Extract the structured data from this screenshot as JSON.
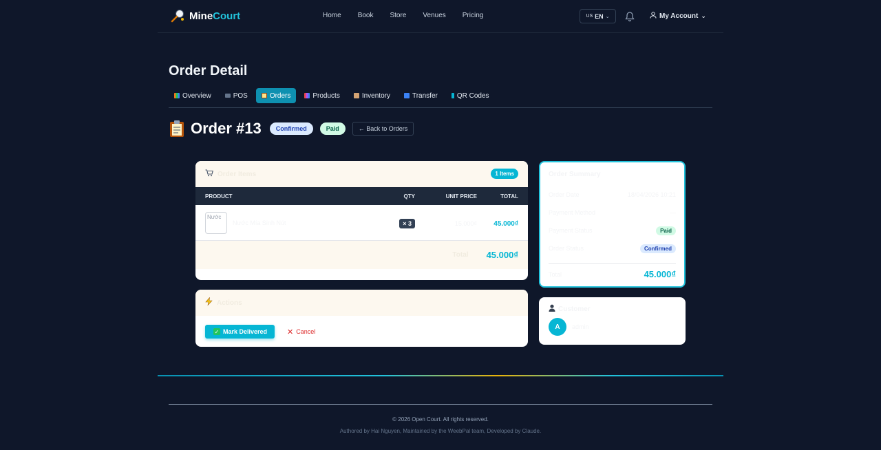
{
  "header": {
    "brand_a": "Mine",
    "brand_b": "Court",
    "nav": [
      "Home",
      "Book",
      "Store",
      "Venues",
      "Pricing"
    ],
    "lang_flag": "US",
    "lang": "EN",
    "account": "My Account"
  },
  "page": {
    "title": "Order Detail",
    "tabs": [
      {
        "label": "Overview",
        "icon": "chart-icon"
      },
      {
        "label": "POS",
        "icon": "laptop-icon"
      },
      {
        "label": "Orders",
        "icon": "clipboard-icon",
        "active": true
      },
      {
        "label": "Products",
        "icon": "bar-chart-icon"
      },
      {
        "label": "Inventory",
        "icon": "box-icon"
      },
      {
        "label": "Transfer",
        "icon": "refresh-icon"
      },
      {
        "label": "QR Codes",
        "icon": "qr-icon"
      }
    ]
  },
  "order": {
    "title": "Order #13",
    "status_badge": "Confirmed",
    "payment_badge": "Paid",
    "back_label": "← Back to Orders"
  },
  "items": {
    "title": "Order Items",
    "count": "1 Items",
    "headers": {
      "product": "PRODUCT",
      "qty": "QTY",
      "unit": "UNIT PRICE",
      "total": "TOTAL"
    },
    "rows": [
      {
        "img_alt": "Nước",
        "name": "Nước Mía Sinh Nút",
        "qty": "× 3",
        "unit": "15.000₫",
        "total": "45.000₫"
      }
    ],
    "total_label": "Total",
    "total_value": "45.000₫"
  },
  "actions": {
    "title": "Actions",
    "deliver_label": "Mark Delivered",
    "cancel_label": "Cancel"
  },
  "summary": {
    "title": "Order Summary",
    "rows": {
      "date_label": "Order Date",
      "date_value": "18/04/2026 10:21",
      "method_label": "Payment Method",
      "method_value": "—",
      "pay_status_label": "Payment Status",
      "pay_status_value": "Paid",
      "order_status_label": "Order Status",
      "order_status_value": "Confirmed"
    },
    "total_label": "Total",
    "total_value": "45.000₫"
  },
  "customer": {
    "title": "Customer",
    "initial": "A",
    "name": "admin"
  },
  "footer": {
    "copyright": "© 2026 Open Court. All rights reserved.",
    "credits": "Authored by Hai Nguyen, Maintained by the WeebPal team, Developed by Claude."
  },
  "colors": {
    "accent": "#06b6d4",
    "background": "#0f172a",
    "danger": "#dc2626"
  }
}
